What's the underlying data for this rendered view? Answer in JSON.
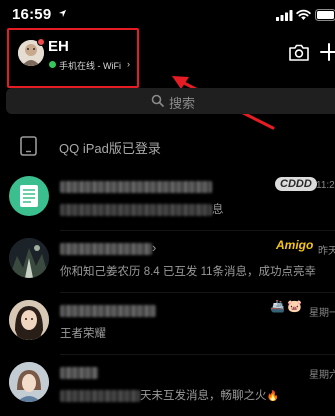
{
  "status_bar": {
    "time": "16:59"
  },
  "profile": {
    "name": "EH",
    "status_text": "手机在线 - WiFi",
    "status_chevron": "›"
  },
  "search": {
    "label": "搜索"
  },
  "device": {
    "label": "QQ iPad版已登录"
  },
  "chats": [
    {
      "title": "",
      "message_suffix": "息",
      "time": "11:2",
      "badge": "CDDD"
    },
    {
      "title": "",
      "title_suffix": "›",
      "message": "你和知己姜农历 8.4 已互发 11条消息，成功点亮幸",
      "time": "昨天",
      "badge": "Amigo"
    },
    {
      "title": "",
      "message": "王者荣耀",
      "time": "星期一"
    },
    {
      "title": "",
      "message_suffix": "天未互发消息，畅聊之火",
      "time": "星期六"
    }
  ],
  "colors": {
    "background": "#000000",
    "highlight_box": "#e51c23",
    "annotation_arrow": "#e51c23",
    "online": "#34c759",
    "secondary_text": "#9a9a9a"
  }
}
